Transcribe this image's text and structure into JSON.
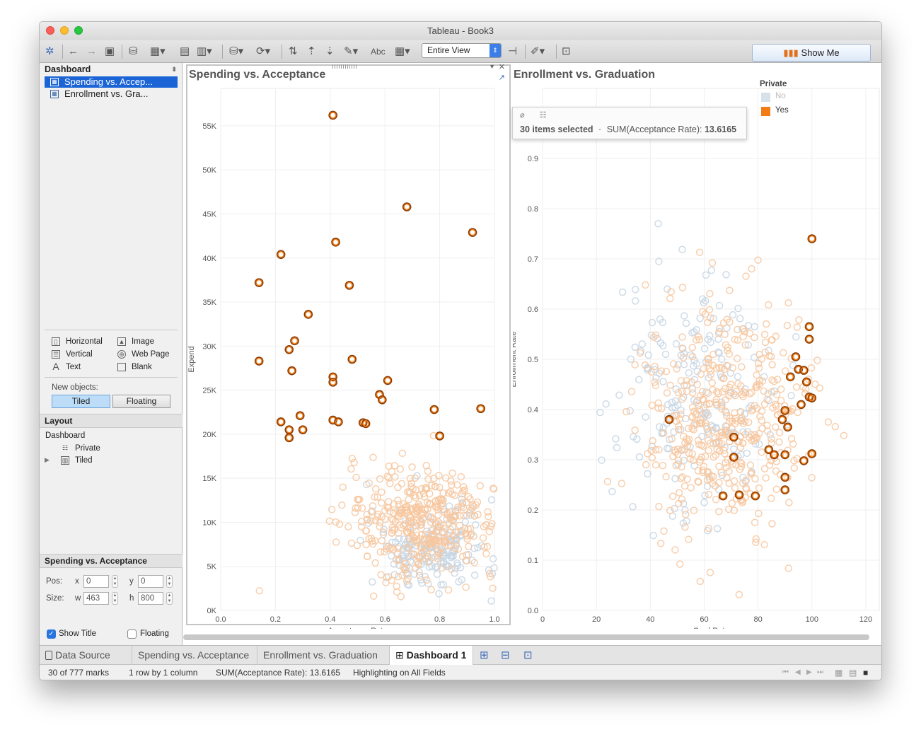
{
  "window": {
    "title": "Tableau - Book3"
  },
  "toolbar": {
    "view_selector": "Entire View",
    "show_me": "Show Me",
    "abc_label": "Abc"
  },
  "left_panel": {
    "dashboard_header": "Dashboard",
    "sheets": [
      {
        "label": "Spending vs. Accep...",
        "selected": true
      },
      {
        "label": "Enrollment vs. Gra...",
        "selected": false
      }
    ],
    "objects": {
      "horizontal": "Horizontal",
      "vertical": "Vertical",
      "text": "Text",
      "image": "Image",
      "web_page": "Web Page",
      "blank": "Blank"
    },
    "new_objects_label": "New objects:",
    "tiled_label": "Tiled",
    "floating_label": "Floating",
    "layout_header": "Layout",
    "layout_tree": {
      "root": "Dashboard",
      "child1": "Private",
      "child2": "Tiled"
    },
    "selected_item_header": "Spending vs. Acceptance",
    "pos_label": "Pos:",
    "size_label": "Size:",
    "x_label": "x",
    "y_label": "y",
    "w_label": "w",
    "h_label": "h",
    "pos_x": "0",
    "pos_y": "0",
    "size_w": "463",
    "size_h": "800",
    "show_title_label": "Show Title",
    "floating_check_label": "Floating"
  },
  "tooltip": {
    "summary_count": "30 items selected",
    "summary_sep": "·",
    "summary_measure": "SUM(Acceptance Rate):",
    "summary_value": "13.6165"
  },
  "legend": {
    "title": "Private",
    "items": [
      {
        "label": "No",
        "color": "#c5d5e3"
      },
      {
        "label": "Yes",
        "color": "#f27d16"
      }
    ]
  },
  "tabs": {
    "data_source": "Data Source",
    "sheet1": "Spending vs. Acceptance",
    "sheet2": "Enrollment vs. Graduation",
    "dashboard": "Dashboard 1"
  },
  "status": {
    "marks": "30 of 777 marks",
    "rows": "1 row by 1 column",
    "sum": "SUM(Acceptance Rate): 13.6165",
    "highlight": "Highlighting on All Fields"
  },
  "colors": {
    "selected_ring": "#8a3d06",
    "selected_fill": "#f27d16",
    "private_no": "#c5d5e3",
    "private_yes": "#f7c79f",
    "accent_blue": "#1a64d6"
  },
  "chart_data": [
    {
      "type": "scatter",
      "title": "Spending vs. Acceptance",
      "xlabel": "Acceptance Rate",
      "ylabel": "Expend",
      "xlim": [
        0.0,
        1.0
      ],
      "ylim": [
        0,
        57000
      ],
      "xticks": [
        "0.0",
        "0.2",
        "0.4",
        "0.6",
        "0.8",
        "1.0"
      ],
      "yticks": [
        "0K",
        "5K",
        "10K",
        "15K",
        "20K",
        "25K",
        "30K",
        "35K",
        "40K",
        "45K",
        "50K",
        "55K"
      ],
      "grid": true,
      "selected_points": [
        {
          "x": 0.41,
          "y": 56200
        },
        {
          "x": 0.68,
          "y": 45800
        },
        {
          "x": 0.92,
          "y": 42900
        },
        {
          "x": 0.42,
          "y": 41800
        },
        {
          "x": 0.22,
          "y": 40400
        },
        {
          "x": 0.14,
          "y": 37200
        },
        {
          "x": 0.47,
          "y": 36900
        },
        {
          "x": 0.32,
          "y": 33600
        },
        {
          "x": 0.27,
          "y": 30600
        },
        {
          "x": 0.25,
          "y": 29600
        },
        {
          "x": 0.14,
          "y": 28300
        },
        {
          "x": 0.48,
          "y": 28500
        },
        {
          "x": 0.26,
          "y": 27200
        },
        {
          "x": 0.41,
          "y": 26500
        },
        {
          "x": 0.41,
          "y": 25900
        },
        {
          "x": 0.61,
          "y": 26100
        },
        {
          "x": 0.58,
          "y": 24500
        },
        {
          "x": 0.59,
          "y": 23900
        },
        {
          "x": 0.78,
          "y": 22800
        },
        {
          "x": 0.95,
          "y": 22900
        },
        {
          "x": 0.29,
          "y": 22100
        },
        {
          "x": 0.22,
          "y": 21400
        },
        {
          "x": 0.41,
          "y": 21600
        },
        {
          "x": 0.43,
          "y": 21400
        },
        {
          "x": 0.52,
          "y": 21300
        },
        {
          "x": 0.53,
          "y": 21200
        },
        {
          "x": 0.25,
          "y": 20500
        },
        {
          "x": 0.3,
          "y": 20500
        },
        {
          "x": 0.25,
          "y": 19600
        },
        {
          "x": 0.8,
          "y": 19800
        }
      ],
      "background_clusters": [
        {
          "series": "No",
          "cx": 0.78,
          "cy": 7000,
          "sx": 0.12,
          "sy": 2500,
          "n": 180
        },
        {
          "series": "Yes",
          "cx": 0.74,
          "cy": 10000,
          "sx": 0.14,
          "sy": 3200,
          "n": 400
        }
      ]
    },
    {
      "type": "scatter",
      "title": "Enrollment vs. Graduation",
      "xlabel": "Grad.Rate",
      "ylabel": "Enrollment Rate",
      "xlim": [
        0,
        125
      ],
      "ylim": [
        0.0,
        1.0
      ],
      "xticks": [
        "0",
        "20",
        "40",
        "60",
        "80",
        "100",
        "120"
      ],
      "yticks": [
        "0.0",
        "0.1",
        "0.2",
        "0.3",
        "0.4",
        "0.5",
        "0.6",
        "0.7",
        "0.8",
        "0.9"
      ],
      "grid": true,
      "selected_points": [
        {
          "x": 100,
          "y": 0.74
        },
        {
          "x": 99,
          "y": 0.565
        },
        {
          "x": 99,
          "y": 0.54
        },
        {
          "x": 94,
          "y": 0.505
        },
        {
          "x": 95,
          "y": 0.48
        },
        {
          "x": 97,
          "y": 0.478
        },
        {
          "x": 92,
          "y": 0.465
        },
        {
          "x": 98,
          "y": 0.455
        },
        {
          "x": 99,
          "y": 0.425
        },
        {
          "x": 100,
          "y": 0.423
        },
        {
          "x": 96,
          "y": 0.41
        },
        {
          "x": 90,
          "y": 0.398
        },
        {
          "x": 89,
          "y": 0.38
        },
        {
          "x": 91,
          "y": 0.365
        },
        {
          "x": 47,
          "y": 0.38
        },
        {
          "x": 71,
          "y": 0.345
        },
        {
          "x": 84,
          "y": 0.32
        },
        {
          "x": 86,
          "y": 0.31
        },
        {
          "x": 90,
          "y": 0.31
        },
        {
          "x": 100,
          "y": 0.312
        },
        {
          "x": 71,
          "y": 0.305
        },
        {
          "x": 97,
          "y": 0.298
        },
        {
          "x": 90,
          "y": 0.265
        },
        {
          "x": 90,
          "y": 0.24
        },
        {
          "x": 67,
          "y": 0.228
        },
        {
          "x": 73,
          "y": 0.23
        },
        {
          "x": 79,
          "y": 0.228
        }
      ],
      "background_clusters": [
        {
          "series": "No",
          "cx": 56,
          "cy": 0.43,
          "sx": 14,
          "sy": 0.12,
          "n": 200
        },
        {
          "series": "Yes",
          "cx": 68,
          "cy": 0.38,
          "sx": 15,
          "sy": 0.11,
          "n": 450
        }
      ]
    }
  ]
}
